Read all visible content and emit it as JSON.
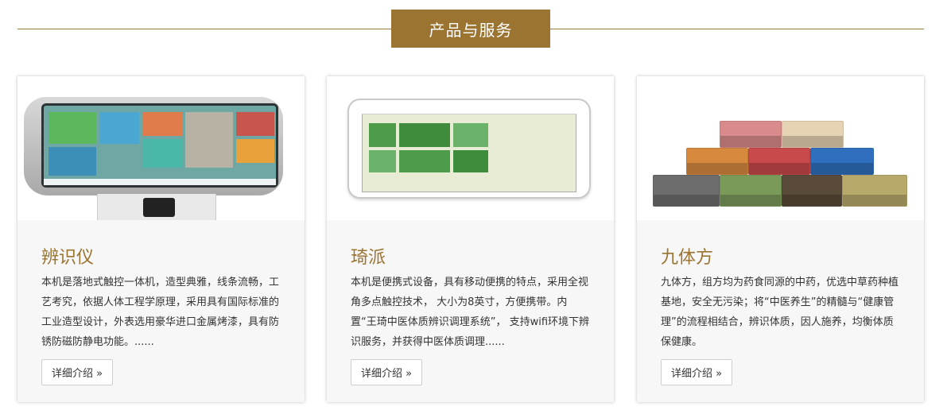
{
  "section": {
    "title": "产品与服务"
  },
  "cards": [
    {
      "title": "辨识仪",
      "description": "本机是落地式触控一体机，造型典雅，线条流畅，工艺考究，依据人体工程学原理，采用具有国际标准的工业造型设计，外表选用豪华进口金属烤漆，具有防锈防磁防静电功能。......",
      "button_label": "详细介绍 »",
      "image_icon": "kiosk-image"
    },
    {
      "title": "琦派",
      "description": "本机是便携式设备，具有移动便携的特点，采用全视角多点触控技术， 大小为8英寸，方便携带。内置“王琦中医体质辨识调理系统”， 支持wifi环境下辨识服务，并获得中医体质调理......",
      "button_label": "详细介绍 »",
      "image_icon": "tablet-image"
    },
    {
      "title": "九体方",
      "description": "九体方，组方均为药食同源的中药，优选中草药种植基地，安全无污染；将“中医养生”的精髓与“健康管理”的流程相结合，辨识体质，因人施养，均衡体质保健康。",
      "button_label": "详细介绍 »",
      "image_icon": "product-boxes-image"
    }
  ],
  "colors": {
    "accent": "#9a7430",
    "card_bg": "#f7f7f7",
    "text": "#333333"
  }
}
